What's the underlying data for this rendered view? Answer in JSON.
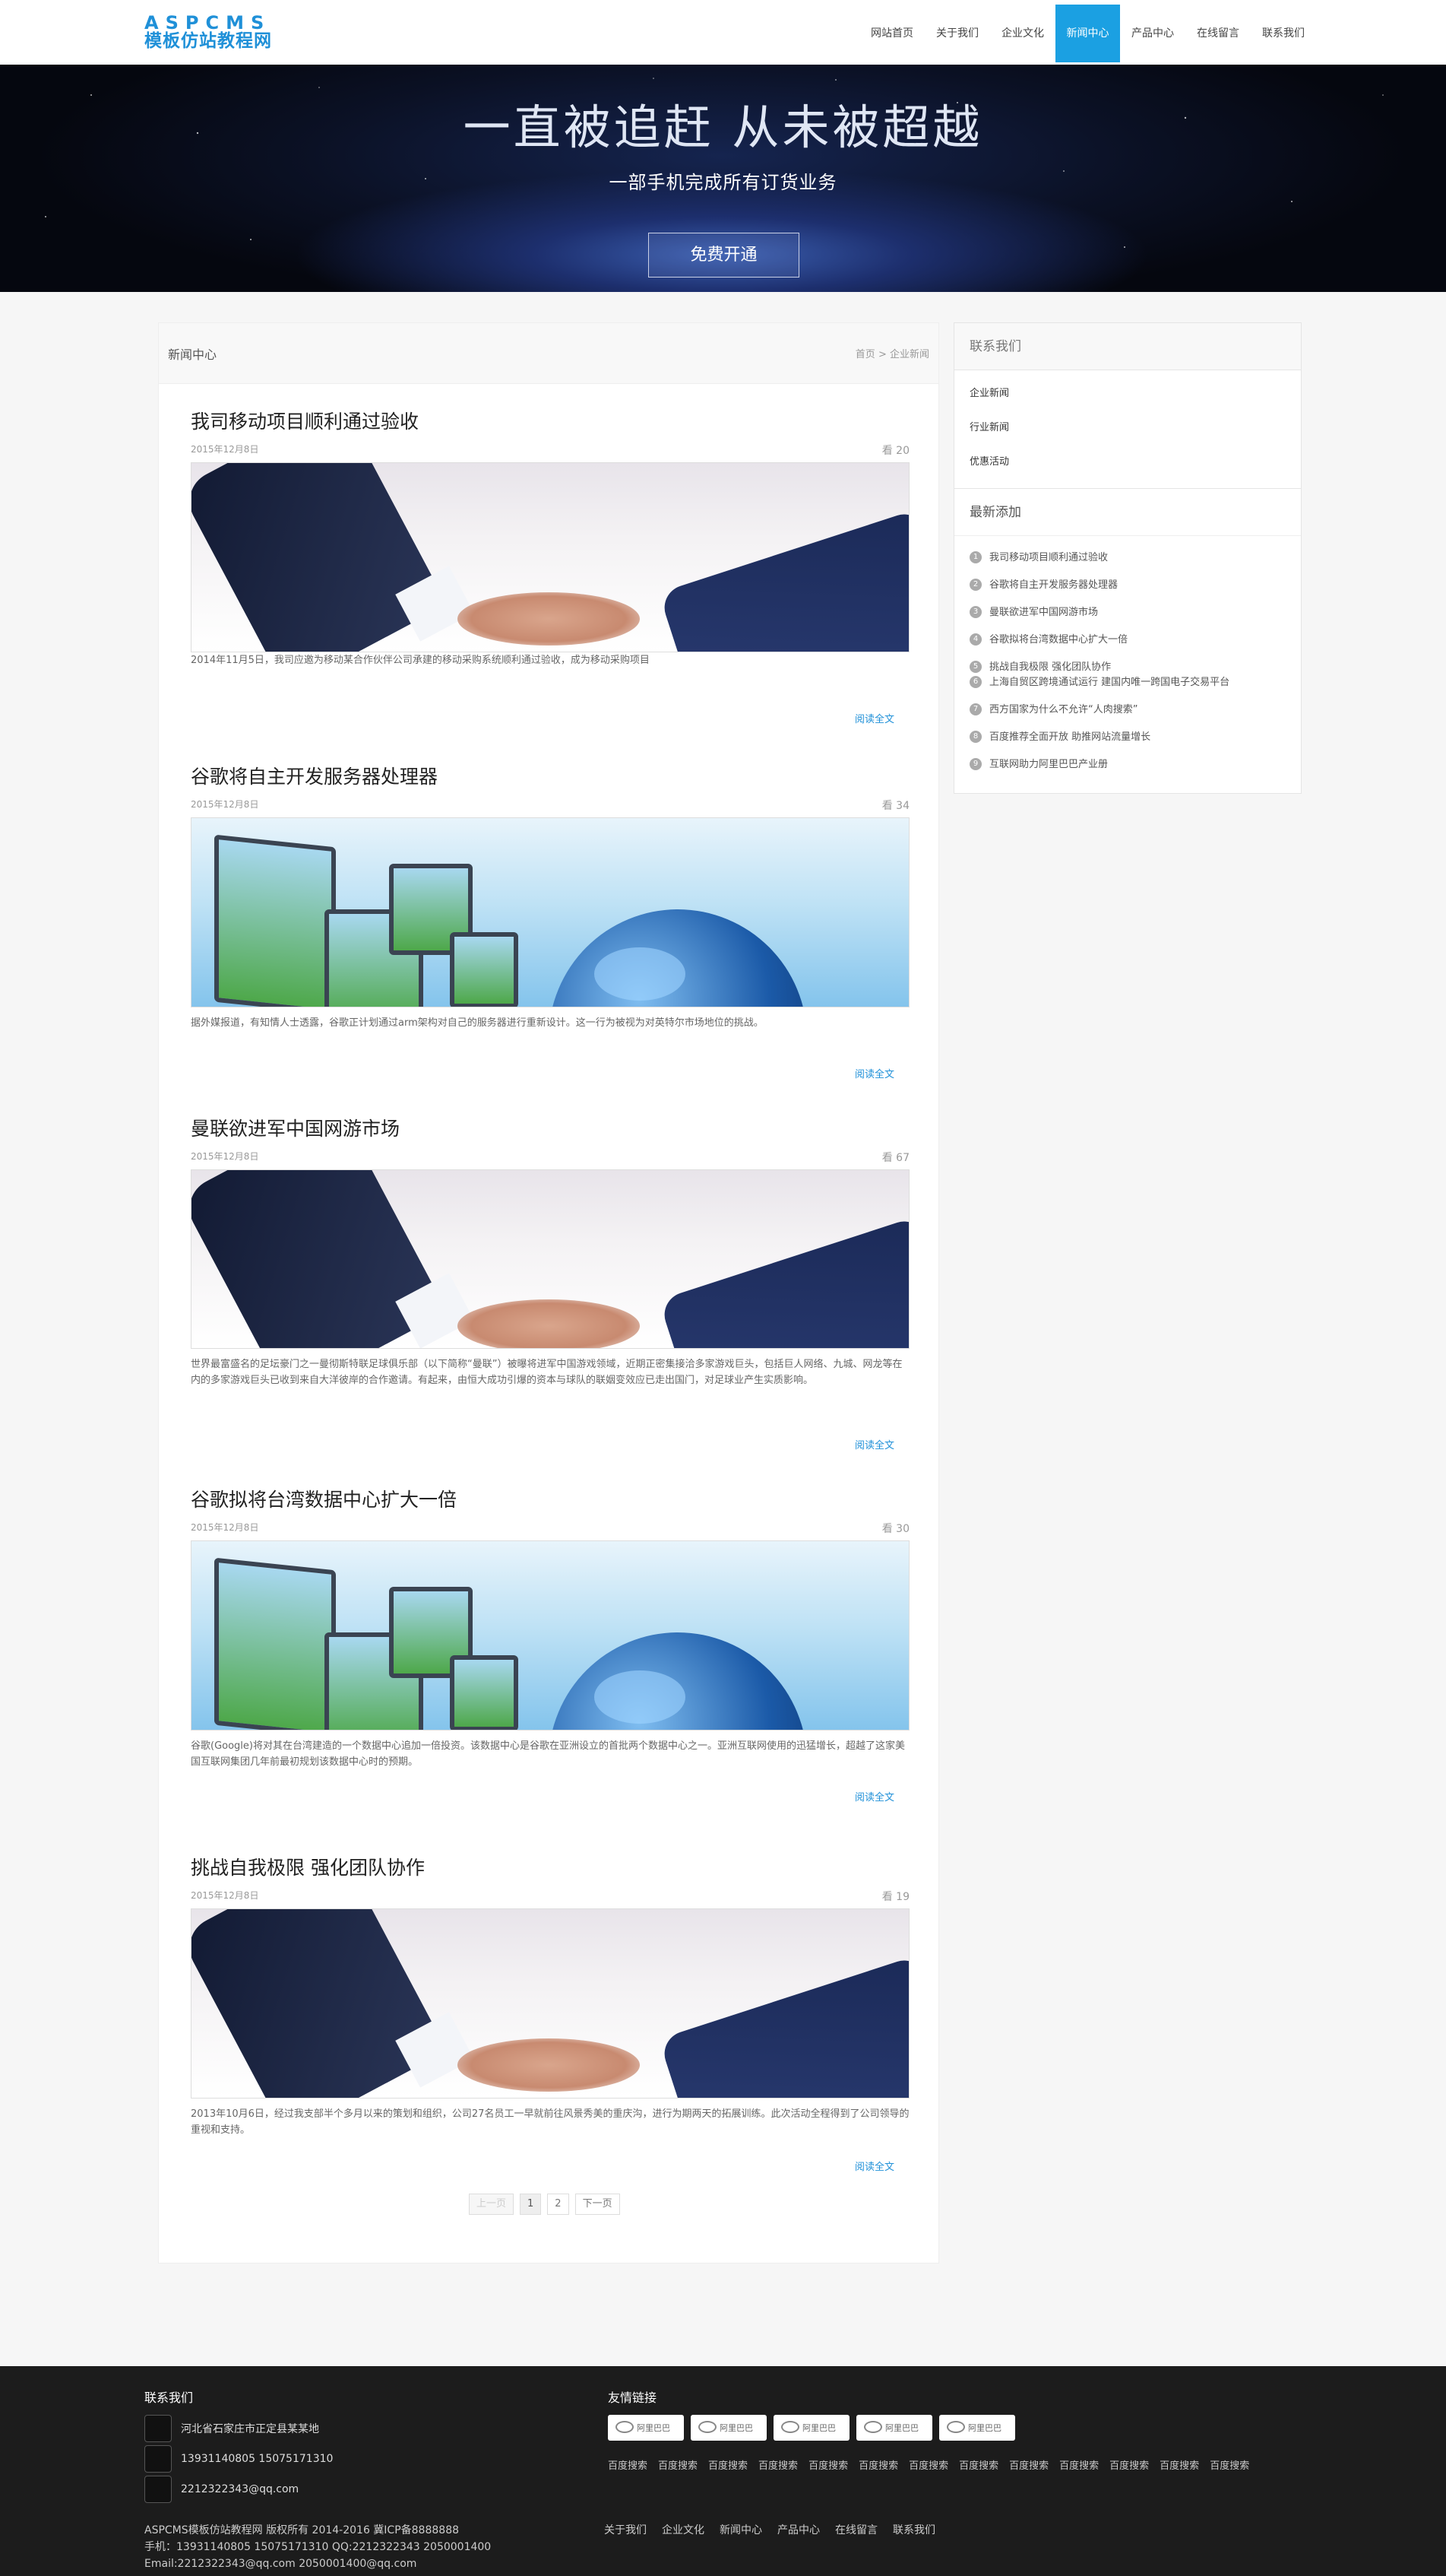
{
  "header": {
    "logo_top": "ASPCMS",
    "logo_bottom": "模板仿站教程网",
    "nav": [
      "网站首页",
      "关于我们",
      "企业文化",
      "新闻中心",
      "产品中心",
      "在线留言",
      "联系我们"
    ],
    "active_nav": "新闻中心"
  },
  "banner": {
    "title": "一直被追赶 从未被超越",
    "subtitle": "一部手机完成所有订货业务",
    "button": "免费开通"
  },
  "content": {
    "title": "新闻中心",
    "breadcrumb_home": "首页",
    "breadcrumb_sep": ">",
    "breadcrumb_current": "企业新闻",
    "more_label": "阅读全文",
    "articles": [
      {
        "title": "我司移动项目顺利通过验收",
        "date": "2015年12月8日",
        "views": "看 20",
        "image": "handshake",
        "desc": "2014年11月5日，我司应邀为移动某合作伙伴公司承建的移动采购系统顺利通过验收，成为移动采购项目"
      },
      {
        "title": "谷歌将自主开发服务器处理器",
        "date": "2015年12月8日",
        "views": "看 34",
        "image": "monitors",
        "desc": "据外媒报道，有知情人士透露，谷歌正计划通过arm架构对自己的服务器进行重新设计。这一行为被视为对英特尔市场地位的挑战。"
      },
      {
        "title": "曼联欲进军中国网游市场",
        "date": "2015年12月8日",
        "views": "看 67",
        "image": "handshake",
        "desc": "世界最富盛名的足坛豪门之一曼彻斯特联足球俱乐部（以下简称“曼联”）被曝将进军中国游戏领域，近期正密集接洽多家游戏巨头，包括巨人网络、九城、网龙等在内的多家游戏巨头已收到来自大洋彼岸的合作邀请。有起来，由恒大成功引爆的资本与球队的联姻变效应已走出国门，对足球业产生实质影响。"
      },
      {
        "title": "谷歌拟将台湾数据中心扩大一倍",
        "date": "2015年12月8日",
        "views": "看 30",
        "image": "monitors",
        "desc": "谷歌(Google)将对其在台湾建造的一个数据中心追加一倍投资。该数据中心是谷歌在亚洲设立的首批两个数据中心之一。亚洲互联网使用的迅猛增长，超越了这家美国互联网集团几年前最初规划该数据中心时的预期。"
      },
      {
        "title": "挑战自我极限 强化团队协作",
        "date": "2015年12月8日",
        "views": "看 19",
        "image": "handshake",
        "desc": "2013年10月6日，经过我支部半个多月以来的策划和组织，公司27名员工一早就前往风景秀美的重庆沟，进行为期两天的拓展训练。此次活动全程得到了公司领导的重视和支持。"
      }
    ],
    "pager": [
      "上一页",
      "1",
      "2",
      "下一页"
    ]
  },
  "sidebar": {
    "contact_title": "联系我们",
    "categories": [
      "企业新闻",
      "行业新闻",
      "优惠活动"
    ],
    "recent_title": "最新添加",
    "recent": [
      "我司移动项目顺利通过验收",
      "谷歌将自主开发服务器处理器",
      "曼联欲进军中国网游市场",
      "谷歌拟将台湾数据中心扩大一倍",
      "挑战自我极限 强化团队协作",
      "上海自贸区跨境通试运行 建国内唯一跨国电子交易平台",
      "西方国家为什么不允许“人肉搜索”",
      "百度推荐全面开放 助推网站流量增长",
      "互联网助力阿里巴巴产业册"
    ]
  },
  "footer": {
    "contact_title": "联系我们",
    "address": "河北省石家庄市正定县某某地",
    "phone": "13931140805 15075171310",
    "email": "2212322343@qq.com",
    "links_title": "友情链接",
    "logo_label": "阿里巴巴",
    "text_links": [
      "百度搜索",
      "百度搜索",
      "百度搜索",
      "百度搜索",
      "百度搜索",
      "百度搜索",
      "百度搜索",
      "百度搜索",
      "百度搜索",
      "百度搜索",
      "百度搜索",
      "百度搜索",
      "百度搜索"
    ],
    "copyright": "ASPCMS模板仿站教程网 版权所有 2014-2016 冀ICP备8888888",
    "phone_line": "手机：13931140805 15075171310 QQ:2212322343 2050001400",
    "email_line": "Email:2212322343@qq.com 2050001400@qq.com",
    "nav": [
      "关于我们",
      "企业文化",
      "新闻中心",
      "产品中心",
      "在线留言",
      "联系我们"
    ]
  }
}
